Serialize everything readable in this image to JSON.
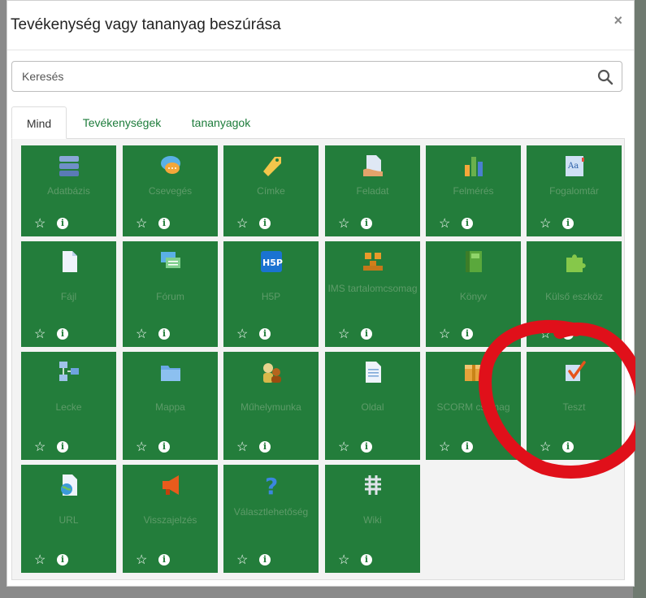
{
  "modal": {
    "title": "Tevékenység vagy tananyag beszúrása",
    "close_label": "×"
  },
  "search": {
    "placeholder": "Keresés"
  },
  "tabs": [
    {
      "label": "Mind",
      "active": true
    },
    {
      "label": "Tevékenységek",
      "active": false
    },
    {
      "label": "tananyagok",
      "active": false
    }
  ],
  "tiles": [
    {
      "name": "Adatbázis",
      "icon": "database-icon"
    },
    {
      "name": "Csevegés",
      "icon": "chat-icon"
    },
    {
      "name": "Címke",
      "icon": "label-icon"
    },
    {
      "name": "Feladat",
      "icon": "assignment-icon"
    },
    {
      "name": "Felmérés",
      "icon": "survey-icon"
    },
    {
      "name": "Fogalomtár",
      "icon": "glossary-icon"
    },
    {
      "name": "Fájl",
      "icon": "file-icon"
    },
    {
      "name": "Fórum",
      "icon": "forum-icon"
    },
    {
      "name": "H5P",
      "icon": "h5p-icon"
    },
    {
      "name": "IMS tartalomcsomag",
      "icon": "ims-package-icon"
    },
    {
      "name": "Könyv",
      "icon": "book-icon"
    },
    {
      "name": "Külső eszköz",
      "icon": "puzzle-icon"
    },
    {
      "name": "Lecke",
      "icon": "lesson-icon"
    },
    {
      "name": "Mappa",
      "icon": "folder-icon"
    },
    {
      "name": "Műhelymunka",
      "icon": "workshop-icon"
    },
    {
      "name": "Oldal",
      "icon": "page-icon"
    },
    {
      "name": "SCORM csomag",
      "icon": "scorm-icon"
    },
    {
      "name": "Teszt",
      "icon": "quiz-icon"
    },
    {
      "name": "URL",
      "icon": "url-icon"
    },
    {
      "name": "Visszajelzés",
      "icon": "megaphone-icon"
    },
    {
      "name": "Választlehetőség",
      "icon": "question-icon"
    },
    {
      "name": "Wiki",
      "icon": "wiki-icon"
    }
  ],
  "tile_actions": {
    "star": "☆",
    "info": "i"
  },
  "colors": {
    "tile_bg": "#237d3b",
    "tab_link": "#1d7c3b",
    "annotation": "#e0101a"
  }
}
